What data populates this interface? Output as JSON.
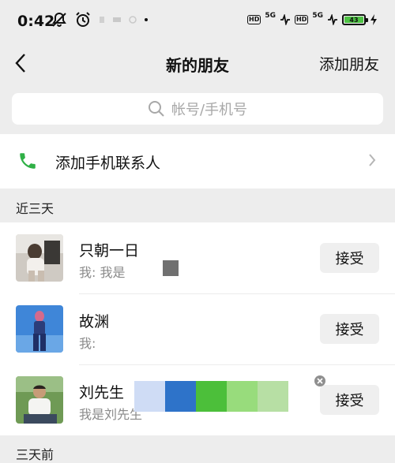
{
  "status_bar": {
    "time": "0:42",
    "hd1": "HD",
    "net1": "5G",
    "hd2": "HD",
    "net2": "5G",
    "battery": "43"
  },
  "nav": {
    "title": "新的朋友",
    "action": "添加朋友"
  },
  "search": {
    "placeholder": "帐号/手机号"
  },
  "add_contacts": {
    "label": "添加手机联系人"
  },
  "sections": {
    "recent": "近三天",
    "older": "三天前"
  },
  "requests": [
    {
      "name": "只朝一日",
      "message": "我: 我是",
      "button": "接受"
    },
    {
      "name": "故渊",
      "message": "我:",
      "button": "接受"
    },
    {
      "name": "刘先生",
      "message": "我是刘先生",
      "button": "接受"
    }
  ],
  "overlay": {
    "palette": [
      "#cfdcf5",
      "#2e73c9",
      "#4cbf3a",
      "#98dc7c",
      "#b7dfa4"
    ]
  },
  "colors": {
    "background": "#ededed",
    "card": "#ffffff",
    "phone_green": "#2fb046",
    "accept_bg": "#efefef"
  }
}
